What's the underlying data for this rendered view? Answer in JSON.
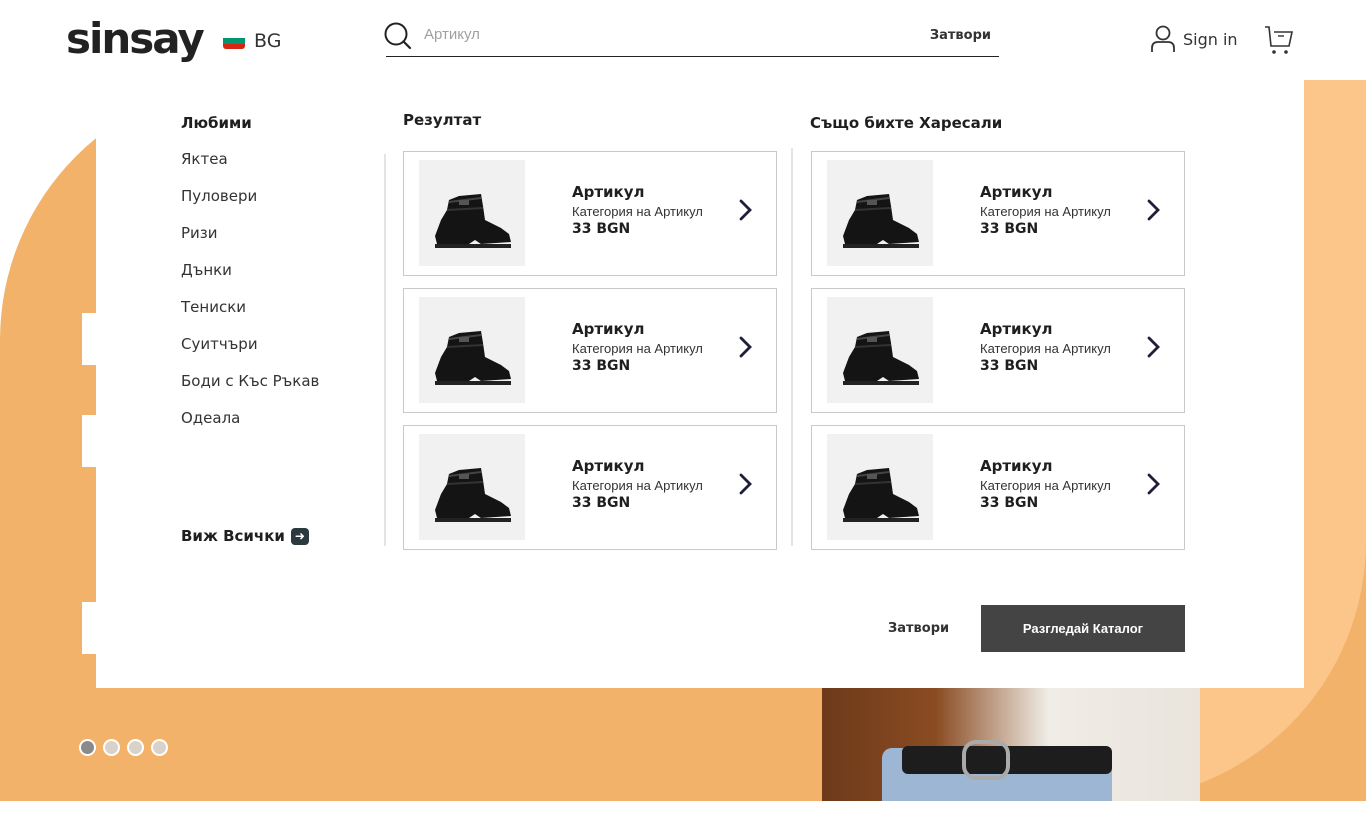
{
  "header": {
    "logo": "sinsay",
    "language": "BG",
    "flag_colors": [
      "#ffffff",
      "#00966e",
      "#d62612"
    ],
    "search": {
      "placeholder": "Артикул",
      "close_label": "Затвори"
    },
    "signin_label": "Sign in",
    "icons": {
      "search": "search-icon",
      "user": "user-icon",
      "cart": "cart-icon"
    }
  },
  "favorites": {
    "title": "Любими",
    "items": [
      "Яктеа",
      "Пуловери",
      "Ризи",
      "Дънки",
      "Тениски",
      "Суитчъри",
      "Боди с Къс Ръкав",
      "Одеала"
    ],
    "see_all_label": "Виж Всички"
  },
  "results": {
    "title": "Резултат",
    "products": [
      {
        "name": "Артикул",
        "category": "Категория на Артикул",
        "price": "33 BGN"
      },
      {
        "name": "Артикул",
        "category": "Категория на Артикул",
        "price": "33 BGN"
      },
      {
        "name": "Артикул",
        "category": "Категория на Артикул",
        "price": "33 BGN"
      }
    ]
  },
  "suggestions": {
    "title": "Също бихте Харесали",
    "products": [
      {
        "name": "Артикул",
        "category": "Категория на Артикул",
        "price": "33 BGN"
      },
      {
        "name": "Артикул",
        "category": "Категория на Артикул",
        "price": "33 BGN"
      },
      {
        "name": "Артикул",
        "category": "Категория на Артикул",
        "price": "33 BGN"
      }
    ]
  },
  "footer": {
    "close_label": "Затвори",
    "catalog_label": "Разгледай Каталог"
  },
  "carousel": {
    "dot_count": 4,
    "active_index": 0
  },
  "colors": {
    "accent_orange": "#f2b26a",
    "light_orange": "#fcc68a",
    "button_dark": "#444444"
  }
}
